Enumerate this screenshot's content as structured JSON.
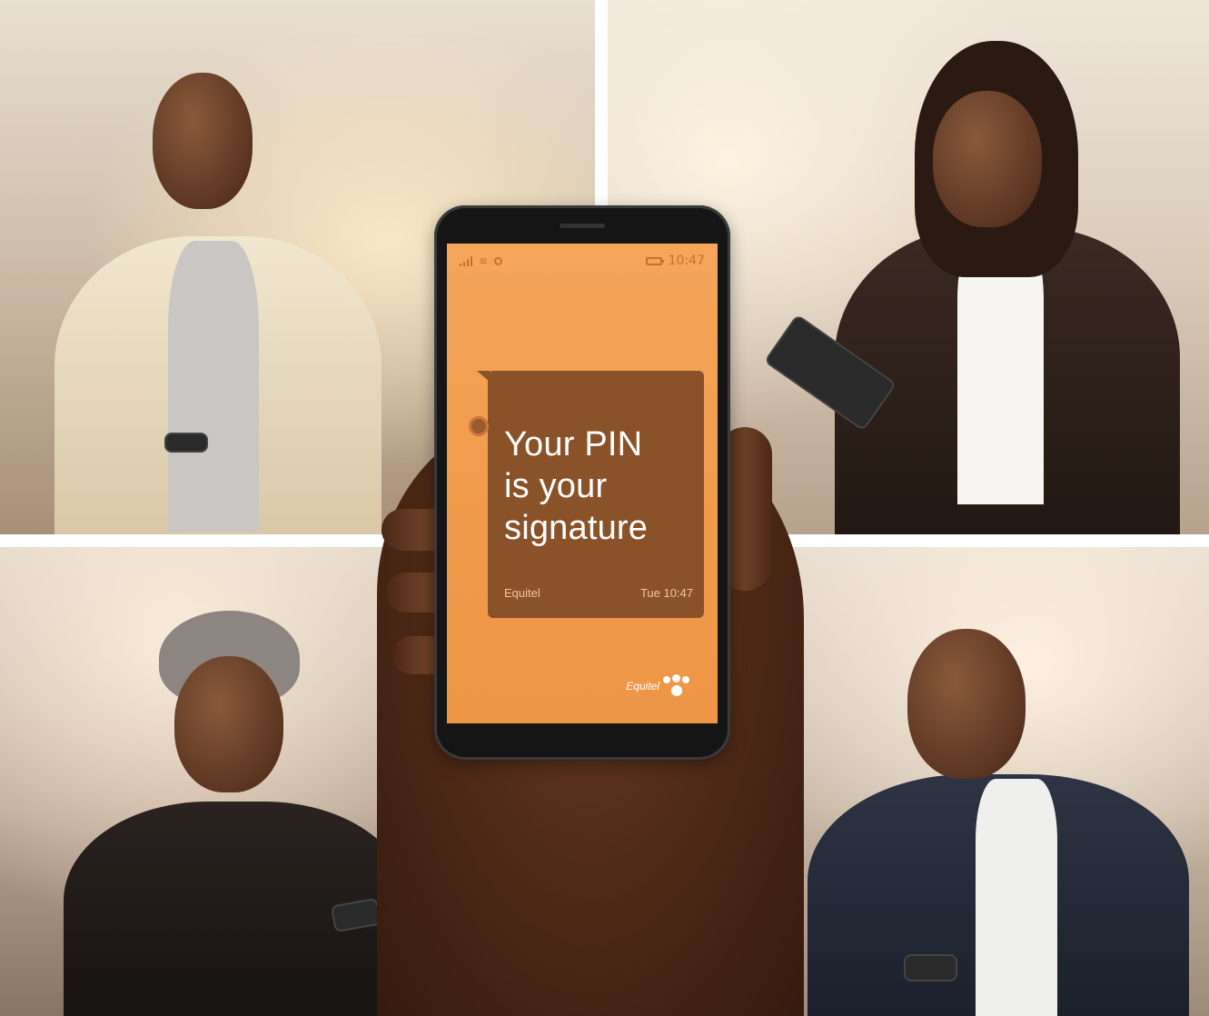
{
  "phone": {
    "status_time": "10:47",
    "message": {
      "line1": "Your PIN",
      "line2": "is your",
      "line3": "signature",
      "sender": "Equitel",
      "timestamp": "Tue 10:47"
    },
    "logo": "Equitel"
  },
  "colors": {
    "screen_orange": "#f19b4d",
    "bubble_brown": "#8a5228"
  },
  "icons": [
    "signal-icon",
    "wifi-icon",
    "alarm-icon",
    "battery-icon"
  ]
}
